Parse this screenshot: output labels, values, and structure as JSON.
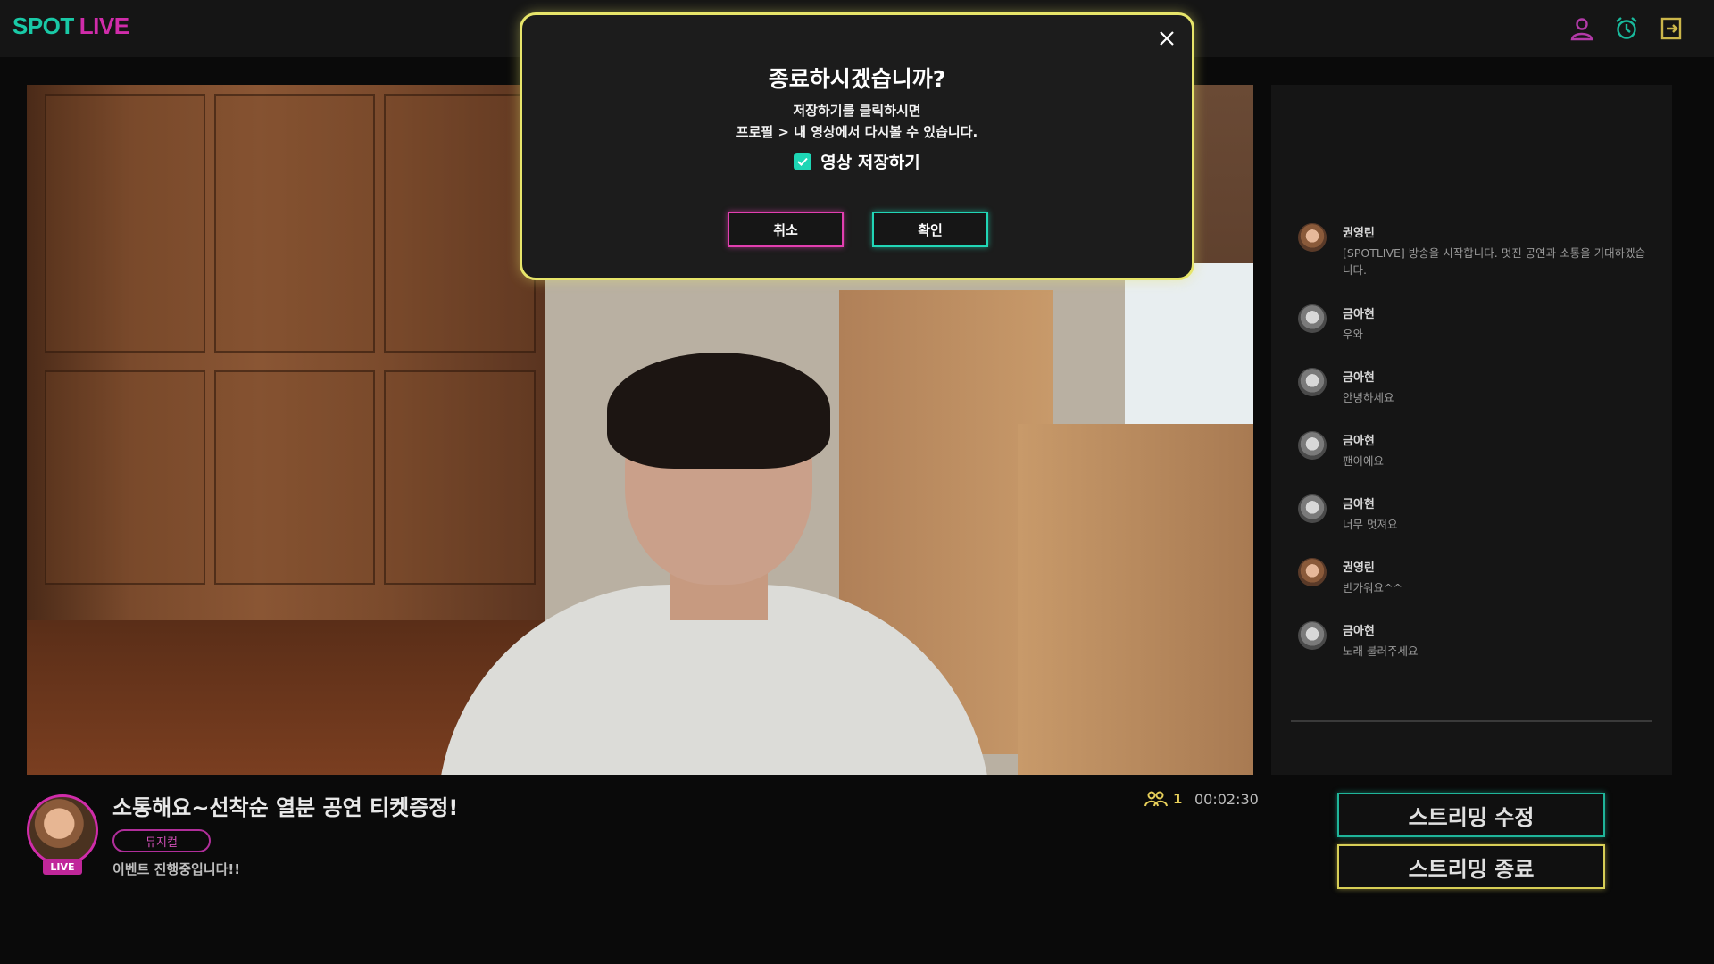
{
  "header": {
    "logo_spot": "SPOT",
    "logo_live": "LIVE",
    "icons": [
      "user-icon",
      "alarm-clock-icon",
      "logout-icon"
    ]
  },
  "modal": {
    "title": "종료하시겠습니까?",
    "line1": "저장하기를 클릭하시면",
    "line2": "프로필 > 내 영상에서 다시볼 수 있습니다.",
    "checkbox_label": "영상 저장하기",
    "checkbox_checked": true,
    "cancel_label": "취소",
    "confirm_label": "확인"
  },
  "chat": {
    "messages": [
      {
        "name": "권영린",
        "text": "[SPOTLIVE] 방송을 시작합니다. 멋진 공연과 소통을 기대하겠습니다."
      },
      {
        "name": "금아현",
        "text": "우와"
      },
      {
        "name": "금아현",
        "text": "안녕하세요"
      },
      {
        "name": "금아현",
        "text": "팬이에요"
      },
      {
        "name": "금아현",
        "text": "너무 멋져요"
      },
      {
        "name": "권영린",
        "text": "반가워요^^"
      },
      {
        "name": "금아현",
        "text": "노래 불러주세요"
      }
    ]
  },
  "stream": {
    "title": "소통해요~선착순 열분 공연 티켓증정!",
    "category": "뮤지컬",
    "description": "이벤트 진행중입니다!!",
    "live_badge": "LIVE",
    "viewer_count": "1",
    "elapsed": "00:02:30"
  },
  "actions": {
    "edit_label": "스트리밍 수정",
    "end_label": "스트리밍 종료"
  },
  "colors": {
    "teal": "#19c9a6",
    "magenta": "#d02caa",
    "yellow": "#e7e56a"
  }
}
